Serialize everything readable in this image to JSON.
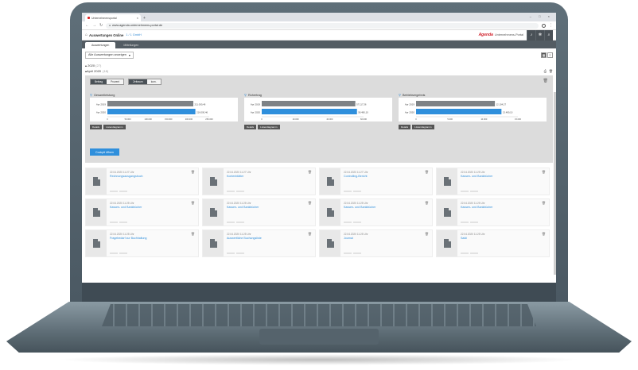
{
  "browser": {
    "tab_title": "Unternehmensportal",
    "url": "www.agenda.unternehmens-portal.de"
  },
  "app": {
    "title": "Auswertungen Online",
    "company": "1 / 1 GmbH",
    "brand_logo": "Agenda",
    "brand_sub": "Unternehmens-Portal"
  },
  "nav": {
    "tabs": [
      {
        "label": "Auswertungen"
      },
      {
        "label": "Mitteilungen"
      }
    ]
  },
  "toolbar": {
    "select_value": "Alle Auswertungen anzeigen"
  },
  "tree": {
    "year": "2020",
    "year_count": "(27)",
    "month": "April 2020",
    "month_count": "(18)"
  },
  "panel": {
    "toggle1": [
      "Beitrag",
      "Prozent"
    ],
    "toggle2": [
      "Zeitraum",
      "kum."
    ],
    "cockpit_label": "Cockpit öffnen",
    "details_label": "Details",
    "listen_label": "Listendiagramm"
  },
  "chart_data": [
    {
      "type": "bar",
      "title": "Gesamtleistung",
      "categories": [
        "Apr 2019",
        "Apr 2020"
      ],
      "values": [
        211000,
        216000
      ],
      "value_labels": [
        "211.000,46",
        "216.000,46"
      ],
      "xticks": [
        "0",
        "50.000",
        "100.000",
        "150.000",
        "200.000",
        "250.000"
      ],
      "xlim": [
        0,
        250000
      ]
    },
    {
      "type": "bar",
      "title": "Rohertrag",
      "categories": [
        "Apr 2019",
        "Apr 2020"
      ],
      "values": [
        57000,
        58000
      ],
      "value_labels": [
        "57.117,36",
        "58.480,10"
      ],
      "xticks": [
        "0",
        "20.000",
        "40.000",
        "60.000"
      ],
      "xlim": [
        0,
        62000
      ]
    },
    {
      "type": "bar",
      "title": "Betriebsergebnis",
      "categories": [
        "Apr 2019",
        "Apr 2020"
      ],
      "values": [
        12000,
        13000
      ],
      "value_labels": [
        "12.104,27",
        "13.480,10"
      ],
      "xticks": [
        "0",
        "5.000",
        "10.000",
        "15.000"
      ],
      "xlim": [
        0,
        15500
      ]
    }
  ],
  "documents": [
    {
      "date": "22.04.2020 11:27 Uhr",
      "name": "Rechnungsausgangsbuch"
    },
    {
      "date": "22.04.2020 11:27 Uhr",
      "name": "Kontenblätter"
    },
    {
      "date": "22.04.2020 11:27 Uhr",
      "name": "Controlling-Bericht"
    },
    {
      "date": "22.04.2020 11:25 Uhr",
      "name": "Kassen- und Bankbücher"
    },
    {
      "date": "22.04.2020 11:25 Uhr",
      "name": "Kassen- und Bankbücher"
    },
    {
      "date": "22.04.2020 11:25 Uhr",
      "name": "Kassen- und Bankbücher"
    },
    {
      "date": "22.04.2020 11:25 Uhr",
      "name": "Kassen- und Bankbücher"
    },
    {
      "date": "22.04.2020 11:25 Uhr",
      "name": "Kassen- und Bankbücher"
    },
    {
      "date": "22.04.2020 11:25 Uhr",
      "name": "Fragebedarf zur Buchhaltung"
    },
    {
      "date": "22.04.2020 11:25 Uhr",
      "name": "Auswertliche Buchungsliste"
    },
    {
      "date": "22.04.2020 11:25 Uhr",
      "name": "Journal"
    },
    {
      "date": "22.04.2020 11:25 Uhr",
      "name": "Saldi"
    }
  ]
}
